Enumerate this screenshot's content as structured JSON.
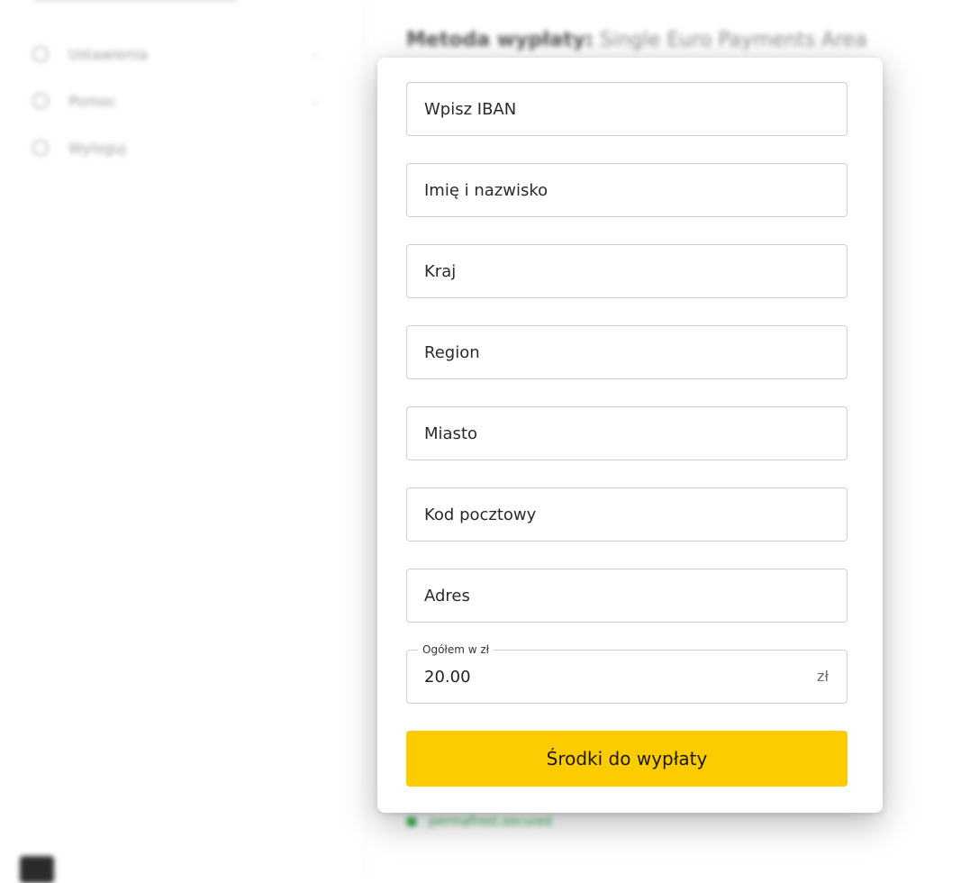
{
  "background": {
    "sidebar_items": [
      {
        "label": "Ustawienia",
        "icon": "gear-icon"
      },
      {
        "label": "Pomoc",
        "icon": "help-icon"
      },
      {
        "label": "Wyloguj",
        "icon": "logout-icon"
      }
    ],
    "method_label": "Metoda wypłaty:",
    "method_value": "Single Euro Payments Area",
    "secured_text": "permafrost.secured"
  },
  "form": {
    "iban_placeholder": "Wpisz IBAN",
    "name_placeholder": "Imię i nazwisko",
    "country_placeholder": "Kraj",
    "region_placeholder": "Region",
    "city_placeholder": "Miasto",
    "postcode_placeholder": "Kod pocztowy",
    "address_placeholder": "Adres",
    "total_label": "Ogółem w zł",
    "total_value": "20.00",
    "currency_suffix": "zł",
    "submit_label": "Środki do wypłaty"
  },
  "colors": {
    "accent": "#fccb00",
    "secured": "#2ea84a"
  }
}
